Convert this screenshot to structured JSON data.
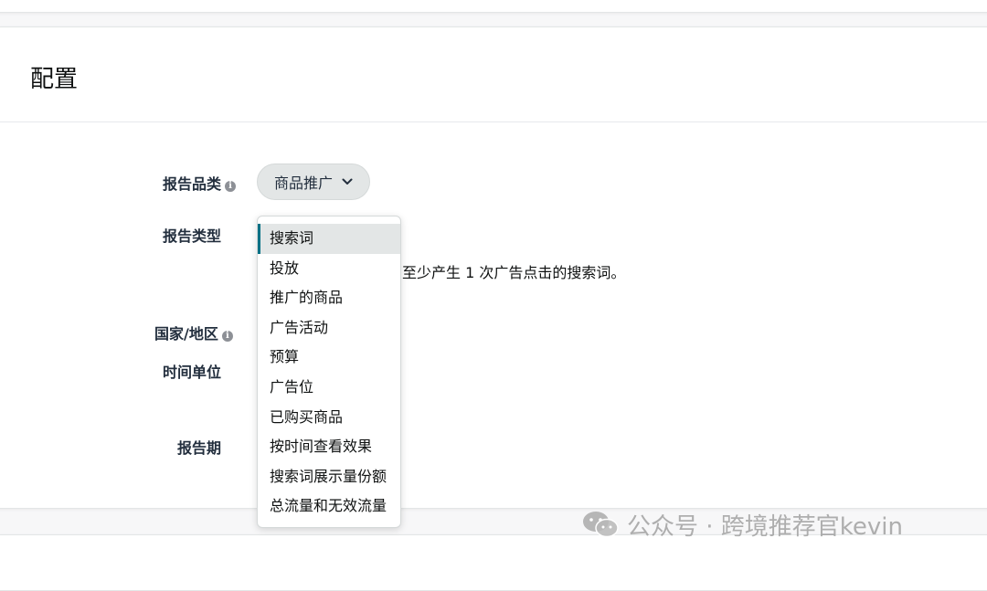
{
  "section": {
    "title": "配置"
  },
  "form": {
    "report_category_label": "报告品类",
    "report_type_label": "报告类型",
    "country_label": "国家/地区",
    "time_unit_label": "时间单位",
    "report_period_label": "报告期",
    "info_icon_glyph": "i"
  },
  "category_select": {
    "selected": "商品推广"
  },
  "report_type": {
    "description_partial": "的至少产生 1 次广告点击的搜索词。",
    "dropdown": {
      "selected_index": 0,
      "items": [
        "搜索词",
        "投放",
        "推广的商品",
        "广告活动",
        "预算",
        "广告位",
        "已购买商品",
        "按时间查看效果",
        "搜索词展示量份额",
        "总流量和无效流量"
      ]
    }
  },
  "watermark": {
    "text": "公众号 · 跨境推荐官kevin",
    "icon": "wechat-icon"
  },
  "colors": {
    "accent": "#007185",
    "pill_bg": "#e3e6e6",
    "label": "#232f3e"
  }
}
